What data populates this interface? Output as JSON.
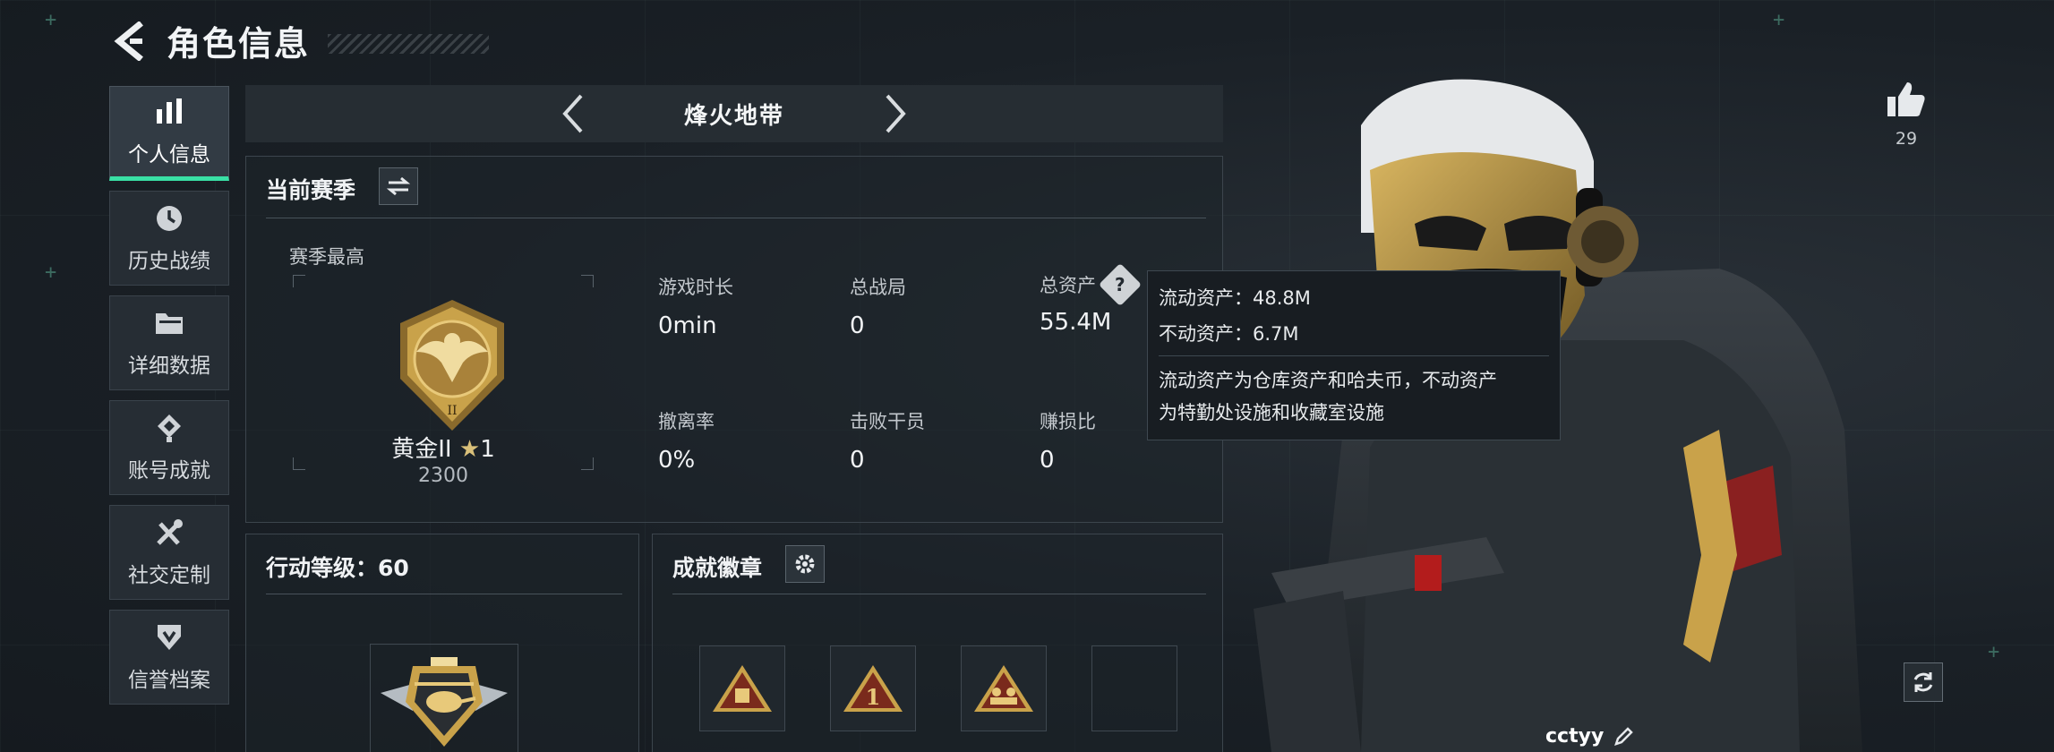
{
  "header": {
    "title": "角色信息"
  },
  "sidebar": {
    "items": [
      {
        "label": "个人信息",
        "icon": "bar-chart-icon",
        "active": true
      },
      {
        "label": "历史战绩",
        "icon": "history-clock-icon",
        "active": false
      },
      {
        "label": "详细数据",
        "icon": "folder-icon",
        "active": false
      },
      {
        "label": "账号成就",
        "icon": "achievement-badge-icon",
        "active": false
      },
      {
        "label": "社交定制",
        "icon": "wrench-screwdriver-icon",
        "active": false
      },
      {
        "label": "信誉档案",
        "icon": "credit-shield-icon",
        "active": false
      }
    ]
  },
  "mode": {
    "title": "烽火地带"
  },
  "season": {
    "title": "当前赛季",
    "best_label": "赛季最高",
    "rank_name": "黄金II",
    "rank_stars": "1",
    "rank_score": "2300",
    "stats": [
      {
        "label": "游戏时长",
        "value": "0min"
      },
      {
        "label": "总战局",
        "value": "0"
      },
      {
        "label": "总资产",
        "value": "55.4M"
      },
      {
        "label": "撤离率",
        "value": "0%"
      },
      {
        "label": "击败干员",
        "value": "0"
      },
      {
        "label": "赚损比",
        "value": "0"
      }
    ]
  },
  "tooltip": {
    "liquid": "流动资产：48.8M",
    "fixed": "不动资产：6.7M",
    "desc1": "流动资产为仓库资产和哈夫币，不动资产",
    "desc2": "为特勤处设施和收藏室设施"
  },
  "action_level": {
    "title": "行动等级：60"
  },
  "achievements": {
    "title": "成就徽章"
  },
  "like": {
    "count": "29"
  },
  "player": {
    "name": "cctyy"
  },
  "colors": {
    "accent": "#39e0a5",
    "gold": "#c9a24a",
    "background": "#1b2127"
  }
}
